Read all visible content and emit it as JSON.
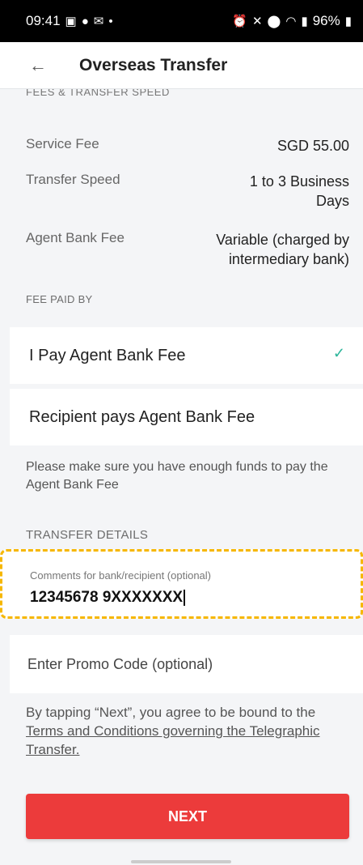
{
  "status_bar": {
    "time": "09:41",
    "battery": "96%",
    "left_icons": [
      "image-icon",
      "chat-icon",
      "mail-icon",
      "dot-icon"
    ],
    "right_icons": [
      "alarm-icon",
      "mute-icon",
      "location-icon",
      "wifi-icon",
      "signal-icon",
      "battery-icon"
    ]
  },
  "app_bar": {
    "title": "Overseas Transfer"
  },
  "fees": {
    "section_cut_label": "FEES & TRANSFER SPEED",
    "service_fee_label": "Service Fee",
    "service_fee_value": "SGD 55.00",
    "transfer_speed_label": "Transfer Speed",
    "transfer_speed_value": "1 to 3 Business Days",
    "agent_fee_label": "Agent Bank Fee",
    "agent_fee_value": "Variable (charged by intermediary bank)"
  },
  "fee_paid_by": {
    "label": "FEE PAID BY",
    "option_1": "I Pay Agent Bank Fee",
    "option_2": "Recipient pays Agent Bank Fee",
    "note": "Please make sure you have enough funds to pay the Agent Bank Fee"
  },
  "transfer_details": {
    "label": "TRANSFER DETAILS",
    "comments_label": "Comments for bank/recipient (optional)",
    "comments_value": "12345678 9XXXXXXX"
  },
  "promo": {
    "label": "Enter Promo Code (optional)"
  },
  "terms": {
    "prefix": "By tapping “Next”, you agree to be bound to the ",
    "link": "Terms and Conditions governing the Telegraphic Transfer."
  },
  "next_label": "NEXT",
  "colors": {
    "accent_red": "#ec3b3b",
    "check_green": "#2bb59a",
    "highlight": "#f6b700"
  }
}
